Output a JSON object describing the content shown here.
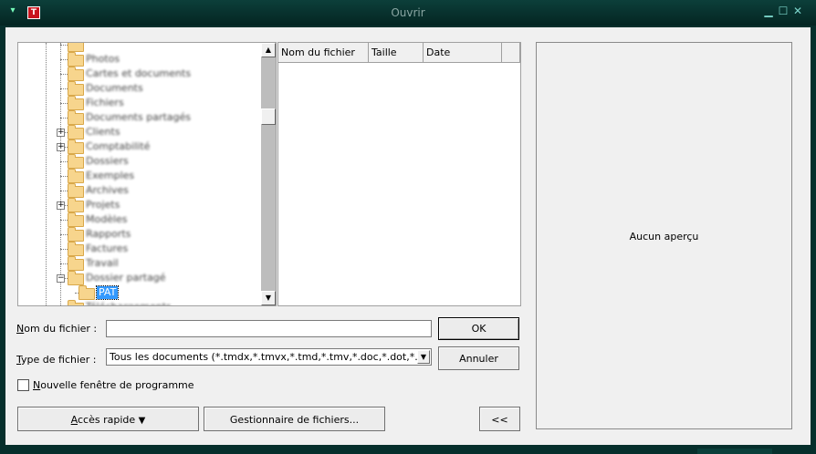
{
  "window": {
    "title": "Ouvrir",
    "app_icon_letter": "T",
    "controls": {
      "system": "▾",
      "minimize": "▁",
      "maximize": "☐",
      "close": "✕"
    }
  },
  "tree": {
    "nodes": [
      {
        "label": "",
        "expander": ""
      },
      {
        "label": "Photos",
        "expander": ""
      },
      {
        "label": "Cartes et documents",
        "expander": ""
      },
      {
        "label": "Documents",
        "expander": ""
      },
      {
        "label": "Fichiers",
        "expander": ""
      },
      {
        "label": "Documents partagés",
        "expander": ""
      },
      {
        "label": "Clients",
        "expander": "+"
      },
      {
        "label": "Comptabilité",
        "expander": "+"
      },
      {
        "label": "Dossiers",
        "expander": ""
      },
      {
        "label": "Exemples",
        "expander": ""
      },
      {
        "label": "Archives",
        "expander": ""
      },
      {
        "label": "Projets",
        "expander": "+"
      },
      {
        "label": "Modèles",
        "expander": ""
      },
      {
        "label": "Rapports",
        "expander": ""
      },
      {
        "label": "Factures",
        "expander": ""
      },
      {
        "label": "Travail",
        "expander": ""
      },
      {
        "label": "Dossier partagé",
        "expander": "−"
      },
      {
        "label": "PAT",
        "expander": "",
        "selected": true
      },
      {
        "label": "Téléchargements",
        "expander": ""
      }
    ],
    "scroll_up": "▲",
    "scroll_down": "▼"
  },
  "file_list": {
    "columns": [
      "Nom du fichier",
      "Taille",
      "Date"
    ]
  },
  "preview": {
    "text": "Aucun aperçu"
  },
  "form": {
    "filename_label_u": "N",
    "filename_label_rest": "om du fichier :",
    "filename_value": "",
    "filetype_label_u": "T",
    "filetype_label_rest": "ype de fichier :",
    "filetype_selected": "Tous les documents (*.tmdx,*.tmvx,*.tmd,*.tmv,*.doc,*.dot,*.docx",
    "filetype_arrow": "▼",
    "ok_label": "OK",
    "cancel_label": "Annuler",
    "new_window_checkbox_label_u": "N",
    "new_window_checkbox_label_rest": "ouvelle fenêtre de programme",
    "new_window_checked": false
  },
  "buttons": {
    "quick_access_u": "A",
    "quick_access_rest": "ccès rapide",
    "quick_access_arrow": "▼",
    "file_manager": "Gestionnaire de fichiers...",
    "toggle_preview": "<<"
  }
}
